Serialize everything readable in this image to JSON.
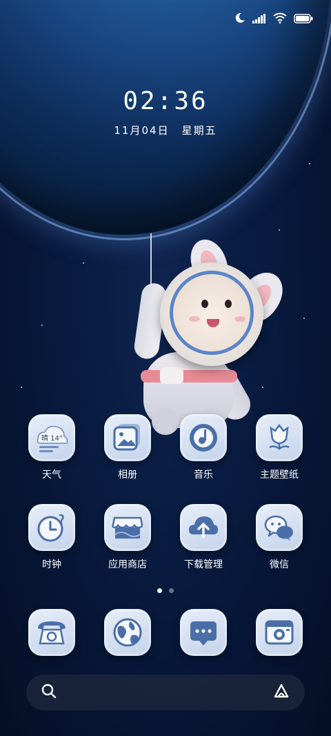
{
  "status_bar": {
    "icons": [
      "moon-icon",
      "signal-icon",
      "wifi-icon",
      "battery-icon"
    ],
    "battery_level": 1.0
  },
  "lockclock": {
    "time": "02:36",
    "date": "11月04日",
    "weekday": "星期五"
  },
  "apps_row1": [
    {
      "label": "天气",
      "icon": "weather-icon",
      "weather_text": "晴 14°"
    },
    {
      "label": "相册",
      "icon": "gallery-icon"
    },
    {
      "label": "音乐",
      "icon": "music-icon"
    },
    {
      "label": "主题壁纸",
      "icon": "themes-icon"
    }
  ],
  "apps_row2": [
    {
      "label": "时钟",
      "icon": "clock-icon"
    },
    {
      "label": "应用商店",
      "icon": "app-store-icon"
    },
    {
      "label": "下载管理",
      "icon": "download-icon"
    },
    {
      "label": "微信",
      "icon": "wechat-icon"
    }
  ],
  "dock": [
    {
      "icon": "phone-icon"
    },
    {
      "icon": "browser-icon"
    },
    {
      "icon": "messages-icon"
    },
    {
      "icon": "camera-icon"
    }
  ],
  "page_indicator": {
    "pages": 2,
    "active": 1
  },
  "search_bar": {
    "icons": [
      "search-icon",
      "assistant-icon"
    ]
  },
  "colors": {
    "icon_tile": "#d6e2f3",
    "icon_glyph": "#4a6fa8",
    "background": "#07142f"
  }
}
